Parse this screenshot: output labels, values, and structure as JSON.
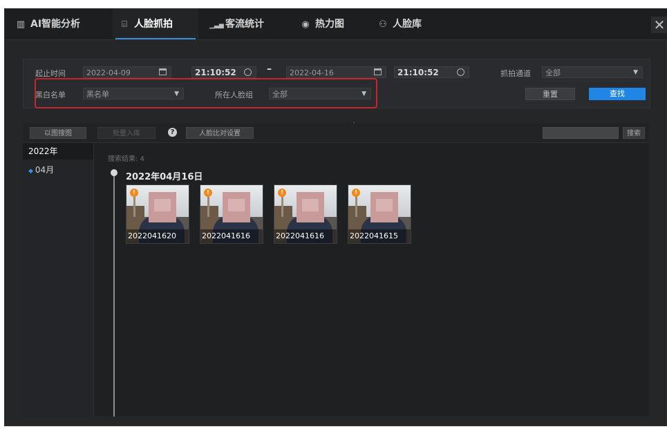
{
  "tabs": [
    {
      "label": "AI智能分析",
      "icon": "ai-analysis-icon",
      "glyph": "▥"
    },
    {
      "label": "人脸抓拍",
      "icon": "face-capture-icon",
      "glyph": "⌸"
    },
    {
      "label": "客流统计",
      "icon": "bar-chart-icon",
      "glyph": "▁▃▅"
    },
    {
      "label": "热力图",
      "icon": "heatmap-icon",
      "glyph": "◉"
    },
    {
      "label": "人脸库",
      "icon": "face-library-icon",
      "glyph": "⚇"
    }
  ],
  "active_tab": "人脸抓拍",
  "close_glyph": "✕",
  "filter": {
    "time_label": "起止时间",
    "start_date": "2022-04-09",
    "start_time": "21:10:52",
    "separator": "–",
    "end_date": "2022-04-16",
    "end_time": "21:10:52",
    "channel_label": "抓拍通道",
    "channel_value": "全部",
    "list_label": "黑白名单",
    "list_value": "黑名单",
    "group_label": "所在人脸组",
    "group_value": "全部",
    "reset_label": "重置",
    "search_label": "查找"
  },
  "toolbar": {
    "search_by_image": "以图搜图",
    "batch_import": "批量入库",
    "help_glyph": "?",
    "compare_settings": "人脸比对设置",
    "search_button": "搜索"
  },
  "sidebar": {
    "year": "2022年",
    "month": "04月"
  },
  "results": {
    "count_label": "搜索结果: 4",
    "date": "2022年04月16日",
    "items": [
      {
        "caption": "2022041620",
        "badge": "!"
      },
      {
        "caption": "2022041616",
        "badge": "!"
      },
      {
        "caption": "2022041616",
        "badge": "!"
      },
      {
        "caption": "2022041615",
        "badge": "!"
      }
    ]
  },
  "colors": {
    "accent": "#3a8dde",
    "primary_button": "#1f86e5",
    "highlight_box": "#c9252c",
    "badge": "#f08a1c"
  }
}
